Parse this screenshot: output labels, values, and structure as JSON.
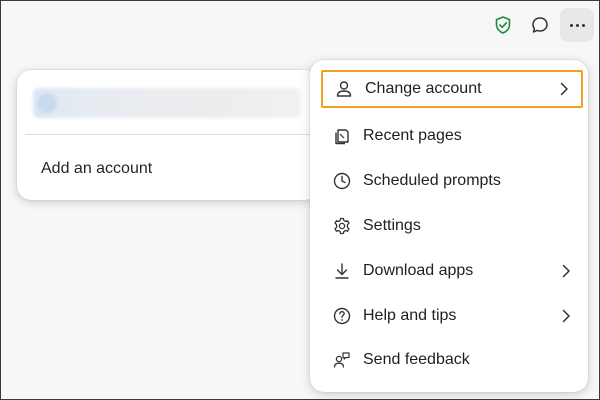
{
  "toolbar": {
    "shield_icon": "shield-check-icon",
    "chat_icon": "chat-bubble-icon",
    "more_icon": "more-horizontal-icon",
    "shield_color": "#1f8a3b"
  },
  "account_panel": {
    "add_account_label": "Add an account"
  },
  "menu": {
    "highlight_color": "#f0a01e",
    "items": [
      {
        "label": "Change account",
        "icon": "person-icon",
        "has_submenu": true,
        "selected": true
      },
      {
        "label": "Recent pages",
        "icon": "pages-stack-icon",
        "has_submenu": false
      },
      {
        "label": "Scheduled prompts",
        "icon": "clock-icon",
        "has_submenu": false
      },
      {
        "label": "Settings",
        "icon": "gear-icon",
        "has_submenu": false
      },
      {
        "label": "Download apps",
        "icon": "download-icon",
        "has_submenu": true
      },
      {
        "label": "Help and tips",
        "icon": "help-icon",
        "has_submenu": true
      },
      {
        "label": "Send feedback",
        "icon": "feedback-icon",
        "has_submenu": false
      }
    ]
  }
}
